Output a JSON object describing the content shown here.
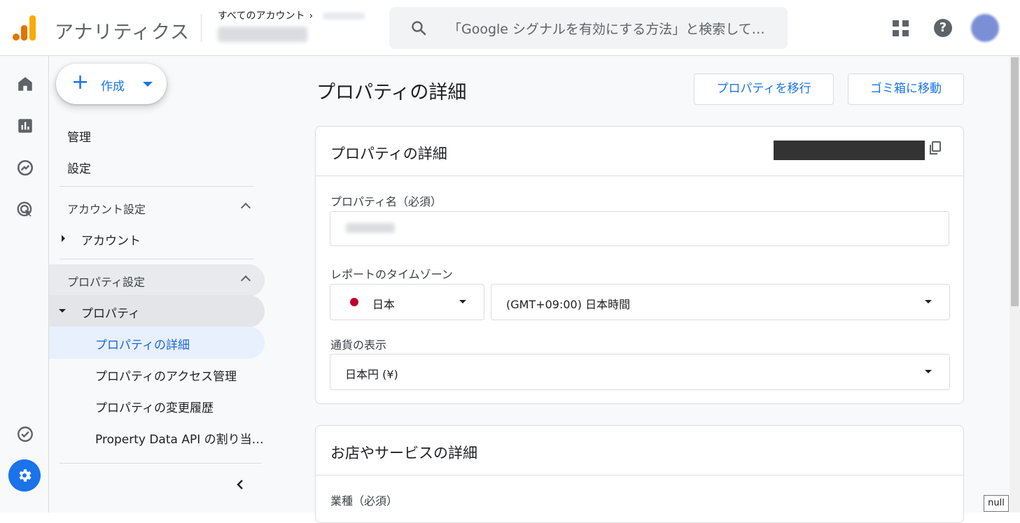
{
  "header": {
    "app_title": "アナリティクス",
    "breadcrumb": "すべてのアカウント",
    "search_placeholder": "「Google シグナルを有効にする方法」と検索して…",
    "icons": [
      "search-icon",
      "apps-icon",
      "help-icon",
      "avatar"
    ]
  },
  "rail": {
    "icons": [
      "home-icon",
      "reports-icon",
      "explore-icon",
      "advertising-icon",
      "configure-icon",
      "admin-settings-icon"
    ]
  },
  "sidenav": {
    "create_label": "作成",
    "top_items": [
      "管理",
      "設定"
    ],
    "account_section": {
      "title": "アカウント設定",
      "item": "アカウント"
    },
    "property_section": {
      "title": "プロパティ設定",
      "item": "プロパティ",
      "subitems": [
        "プロパティの詳細",
        "プロパティのアクセス管理",
        "プロパティの変更履歴",
        "Property Data API の割り当…"
      ],
      "active_index": 0
    }
  },
  "main": {
    "page_title": "プロパティの詳細",
    "move_property_button": "プロパティを移行",
    "trash_button": "ゴミ箱に移動",
    "details_card": {
      "title": "プロパティの詳細",
      "property_name_label": "プロパティ名（必須）",
      "timezone_label": "レポートのタイムゾーン",
      "country": "日本",
      "timezone": "(GMT+09:00) 日本時間",
      "currency_label": "通貨の表示",
      "currency": "日本円 (¥)"
    },
    "business_card": {
      "title": "お店やサービスの詳細",
      "industry_label": "業種（必須）"
    }
  },
  "tooltip": "null",
  "colors": {
    "accent": "#1a73e8",
    "logo_orange": "#f9ab00",
    "logo_dark_orange": "#e37400",
    "japan_flag_red": "#bc002d"
  }
}
